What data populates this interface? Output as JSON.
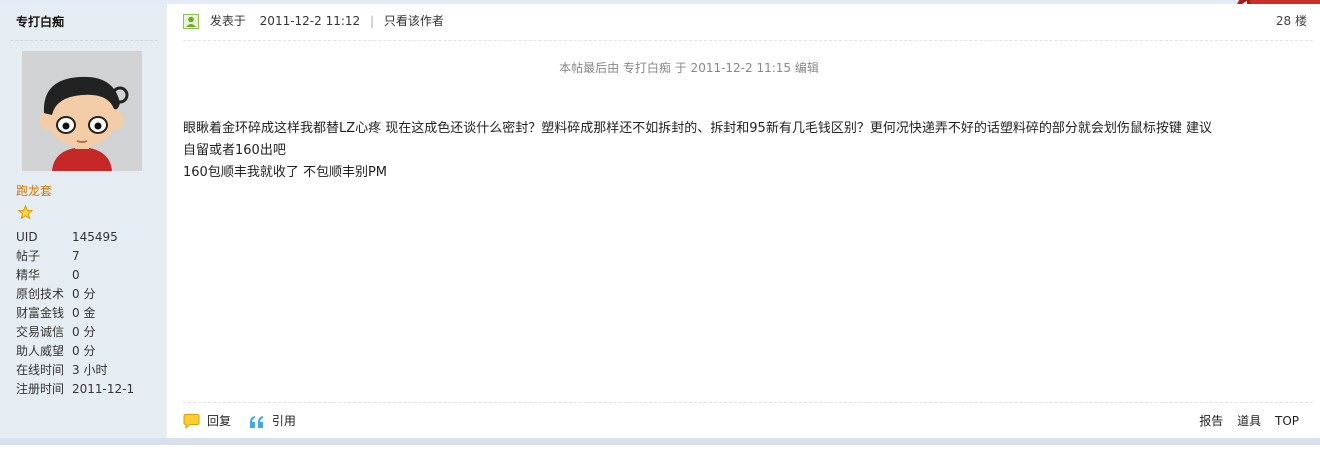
{
  "user": {
    "name": "专打白痴",
    "group": "跑龙套",
    "stats": [
      {
        "label": "UID",
        "value": "145495"
      },
      {
        "label": "帖子",
        "value": "7"
      },
      {
        "label": "精华",
        "value": "0"
      },
      {
        "label": "原创技术",
        "value": "0 分"
      },
      {
        "label": "财富金钱",
        "value": "0 金"
      },
      {
        "label": "交易诚信",
        "value": "0 分"
      },
      {
        "label": "助人威望",
        "value": "0 分"
      },
      {
        "label": "在线时间",
        "value": "3 小时"
      },
      {
        "label": "注册时间",
        "value": "2011-12-1"
      }
    ]
  },
  "post": {
    "posted_label": "发表于",
    "posted_time": "2011-12-2 11:12",
    "only_author": "只看该作者",
    "floor": "28 楼",
    "edit_note": "本帖最后由 专打白痴 于 2011-12-2 11:15 编辑",
    "content_lines": [
      "眼瞅着金环碎成这样我都替LZ心疼  现在这成色还谈什么密封？塑料碎成那样还不如拆封的、拆封和95新有几毛钱区别？更何况快递弄不好的话塑料碎的部分就会划伤鼠标按键  建议",
      "自留或者160出吧",
      "160包顺丰我就收了  不包顺丰别PM"
    ]
  },
  "actions": {
    "reply": "回复",
    "quote": "引用",
    "report": "报告",
    "tools": "道具",
    "top": "TOP"
  },
  "colors": {
    "sidebar_bg": "#e5edf2",
    "group_color": "#d07600",
    "accent_blue": "#1aa8e8"
  }
}
